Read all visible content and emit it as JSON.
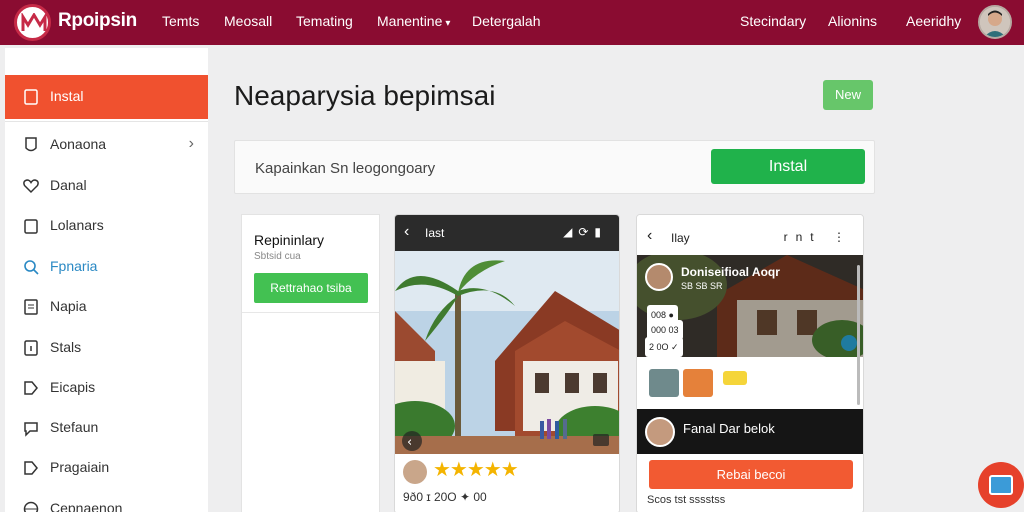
{
  "topbar": {
    "brand": "Rpoipsin",
    "nav": [
      {
        "label": "Temts"
      },
      {
        "label": "Meosall"
      },
      {
        "label": "Temating"
      },
      {
        "label": "Manentine",
        "has_dropdown": true
      },
      {
        "label": "Detergalah"
      }
    ],
    "right_nav": [
      {
        "label": "Stecindary"
      },
      {
        "label": "Alionins"
      },
      {
        "label": "Aeeridhy"
      }
    ],
    "colors": {
      "bar": "#8a0c31"
    }
  },
  "sidebar": {
    "items": [
      {
        "label": "Instal",
        "icon": "file-icon",
        "active": true
      },
      {
        "label": "Aonaona",
        "icon": "shield-icon",
        "chevron": true
      },
      {
        "label": "Danal",
        "icon": "heart-icon"
      },
      {
        "label": "Lolanars",
        "icon": "square-icon"
      },
      {
        "label": "Fpnaria",
        "icon": "search-icon",
        "accent": true
      },
      {
        "label": "Napia",
        "icon": "document-icon"
      },
      {
        "label": "Stals",
        "icon": "info-icon"
      },
      {
        "label": "Eicapis",
        "icon": "tag-icon"
      },
      {
        "label": "Stefaun",
        "icon": "chat-icon"
      },
      {
        "label": "Pragaiain",
        "icon": "tag-icon"
      },
      {
        "label": "Cepnaenon",
        "icon": "globe-icon"
      }
    ],
    "colors": {
      "active": "#f0512f",
      "accent": "#2a89c4"
    }
  },
  "main": {
    "title": "Neaparysia bepimsai",
    "new_button": "New",
    "panel_text": "Kapainkan Sn leogongoary",
    "install_button": "Instal",
    "card": {
      "title": "Repininlary",
      "subtitle": "Sbtsid cua",
      "button": "Rettrahao tsiba"
    },
    "phone1": {
      "title": "Iast",
      "rating_stars": 5,
      "stats": "9ð0  ɪ 20O  ✦ 00"
    },
    "phone2": {
      "title": "Ilay",
      "menu_text": "rnt",
      "overlay_name": "Doniseifioal Aoqr",
      "overlay_sub": "SB SB SR",
      "chips": [
        "008  ●",
        "000  03",
        "2 0O  ✓"
      ],
      "profile_name": "Fanal Dar belok",
      "cta": "Rebai becoi",
      "meta": "Scos tst sssstss"
    }
  },
  "colors": {
    "install_green": "#20b24b",
    "new_green": "#67c66a",
    "card_green": "#43c152",
    "cta_orange": "#f25a32",
    "fab": "#e6412b",
    "star": "#f4b400"
  }
}
